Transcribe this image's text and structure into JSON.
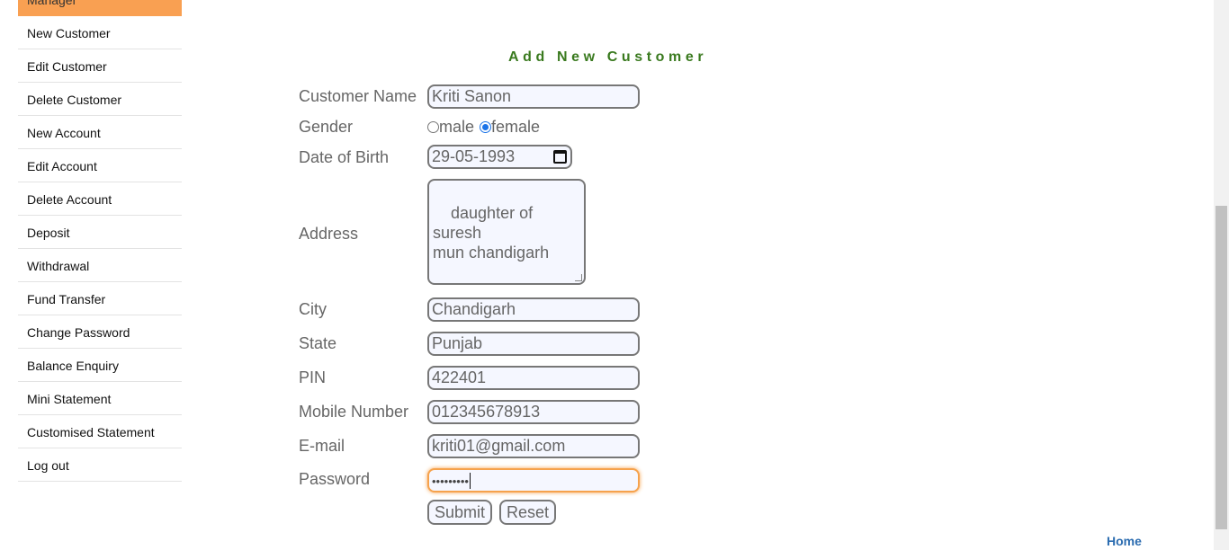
{
  "sidebar": {
    "header": "Manager",
    "items": [
      {
        "label": "New Customer"
      },
      {
        "label": "Edit Customer"
      },
      {
        "label": "Delete Customer"
      },
      {
        "label": "New Account"
      },
      {
        "label": "Edit Account"
      },
      {
        "label": "Delete Account"
      },
      {
        "label": "Deposit"
      },
      {
        "label": "Withdrawal"
      },
      {
        "label": "Fund Transfer"
      },
      {
        "label": "Change Password"
      },
      {
        "label": "Balance Enquiry"
      },
      {
        "label": "Mini Statement"
      },
      {
        "label": "Customised Statement"
      },
      {
        "label": "Log out"
      }
    ]
  },
  "form": {
    "title": "Add New Customer",
    "labels": {
      "customer_name": "Customer Name",
      "gender": "Gender",
      "dob": "Date of Birth",
      "address": "Address",
      "city": "City",
      "state": "State",
      "pin": "PIN",
      "mobile": "Mobile Number",
      "email": "E-mail",
      "password": "Password"
    },
    "values": {
      "customer_name": "Kriti Sanon",
      "gender_male": "male",
      "gender_female": "female",
      "gender_selected": "female",
      "dob": "29-05-1993",
      "address": "daughter of suresh\nmun chandigarh",
      "city": "Chandigarh",
      "state": "Punjab",
      "pin": "422401",
      "mobile": "012345678913",
      "email": "kriti01@gmail.com",
      "password_masked": "•••••••••"
    },
    "buttons": {
      "submit": "Submit",
      "reset": "Reset"
    }
  },
  "footer": {
    "home_link": "Home"
  },
  "colors": {
    "sidebar_header": "#f9a052",
    "title": "#3a7a1f",
    "focus": "#f6a24c",
    "link": "#2b6cb0"
  }
}
